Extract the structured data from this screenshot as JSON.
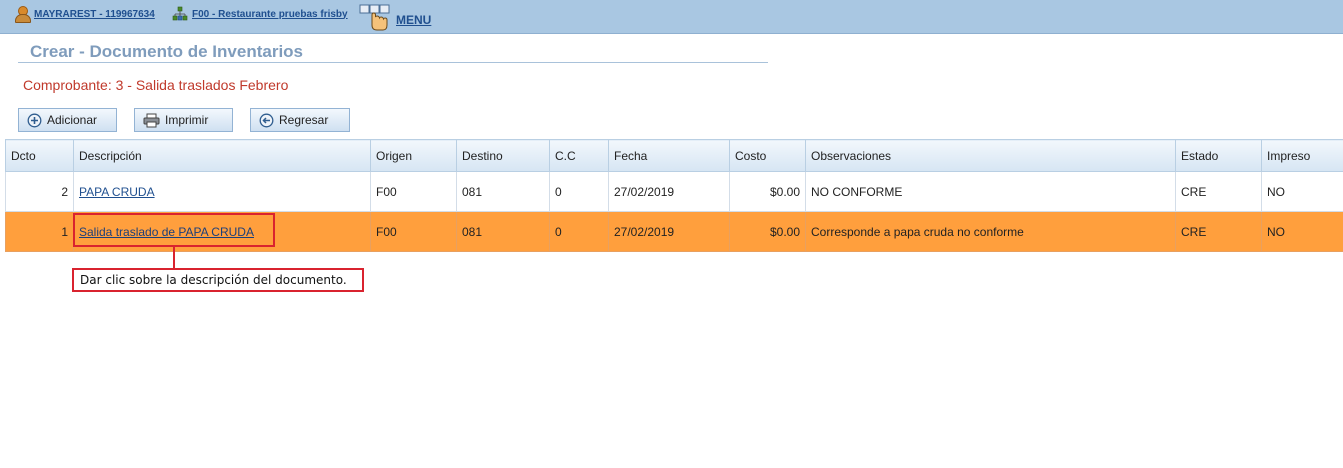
{
  "topbar": {
    "user_label": "MAYRAREST - 119967634",
    "company_label": "F00 - Restaurante pruebas frisby",
    "menu_label": "MENU",
    "icons": {
      "user": "user-icon",
      "company": "org-chart-icon",
      "menu": "hand-pointer-icon"
    }
  },
  "page": {
    "title": "Crear - Documento de Inventarios",
    "subtitle": "Comprobante: 3 - Salida traslados Febrero"
  },
  "toolbar": {
    "add_label": "Adicionar",
    "print_label": "Imprimir",
    "back_label": "Regresar",
    "icons": {
      "add": "plus-circle-icon",
      "print": "printer-icon",
      "back": "arrow-left-circle-icon"
    }
  },
  "grid": {
    "columns": [
      "Dcto",
      "Descripción",
      "Origen",
      "Destino",
      "C.C",
      "Fecha",
      "Costo",
      "Observaciones",
      "Estado",
      "Impreso"
    ],
    "rows": [
      {
        "dcto": "2",
        "descripcion": "PAPA CRUDA",
        "origen": "F00",
        "destino": "081",
        "cc": "0",
        "fecha": "27/02/2019",
        "costo": "$0.00",
        "observaciones": "NO CONFORME",
        "estado": "CRE",
        "impreso": "NO"
      },
      {
        "dcto": "1",
        "descripcion": "Salida traslado de PAPA CRUDA",
        "origen": "F00",
        "destino": "081",
        "cc": "0",
        "fecha": "27/02/2019",
        "costo": "$0.00",
        "observaciones": "Corresponde a papa cruda no conforme",
        "estado": "CRE",
        "impreso": "NO"
      }
    ],
    "selected_row_color": "#ff9f3d"
  },
  "annotation": {
    "text": "Dar clic sobre la descripción del documento.",
    "color": "#d9232f"
  }
}
